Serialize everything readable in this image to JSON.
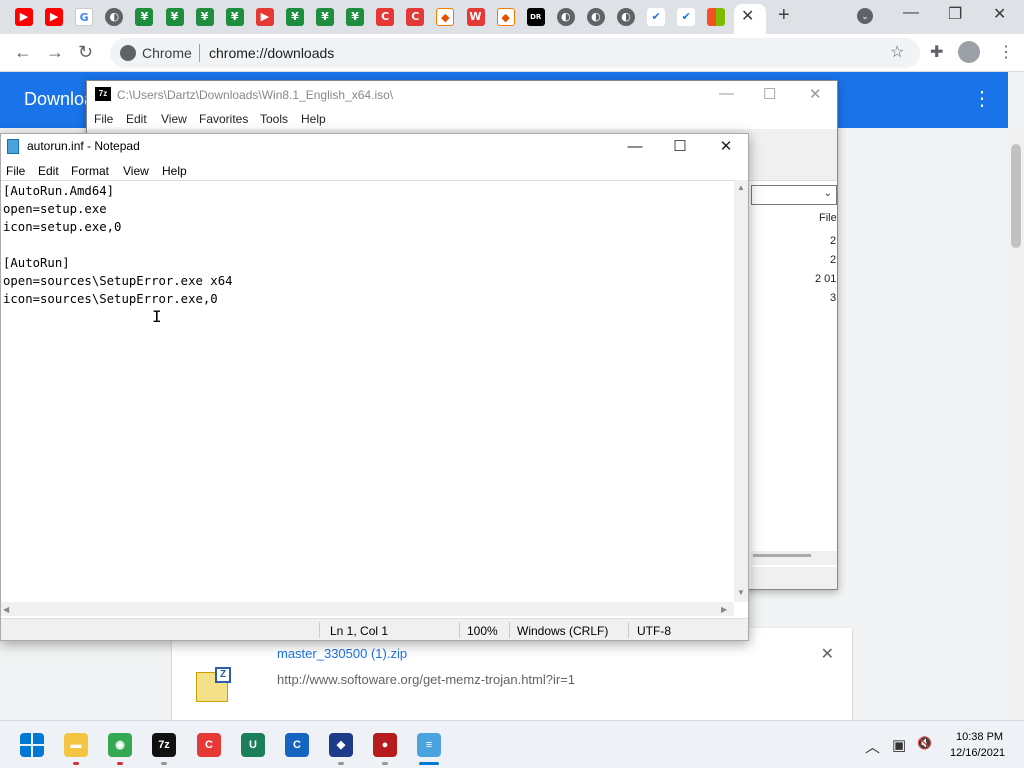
{
  "browser": {
    "tabs": [
      {
        "icon": "youtube-icon",
        "glyph": "▶",
        "style": "yt"
      },
      {
        "icon": "youtube-icon",
        "glyph": "▶",
        "style": "yt"
      },
      {
        "icon": "google-icon",
        "glyph": "G",
        "style": "gg"
      },
      {
        "icon": "globe-icon",
        "glyph": "◐",
        "style": "globe"
      },
      {
        "icon": "download-arrow-icon",
        "glyph": "¥",
        "style": "green"
      },
      {
        "icon": "download-arrow-icon",
        "glyph": "¥",
        "style": "green"
      },
      {
        "icon": "download-arrow-icon",
        "glyph": "¥",
        "style": "green"
      },
      {
        "icon": "download-arrow-icon",
        "glyph": "¥",
        "style": "green"
      },
      {
        "icon": "play-logo-icon",
        "glyph": "▶",
        "style": "red"
      },
      {
        "icon": "download-arrow-icon",
        "glyph": "¥",
        "style": "green"
      },
      {
        "icon": "download-arrow-icon",
        "glyph": "¥",
        "style": "green"
      },
      {
        "icon": "download-arrow-icon",
        "glyph": "¥",
        "style": "green"
      },
      {
        "icon": "ccleaner-icon",
        "glyph": "C",
        "style": "red"
      },
      {
        "icon": "ccleaner-icon",
        "glyph": "C",
        "style": "red"
      },
      {
        "icon": "diamond-icon",
        "glyph": "◆",
        "style": "orange"
      },
      {
        "icon": "w-logo-icon",
        "glyph": "W",
        "style": "red"
      },
      {
        "icon": "diamond-icon",
        "glyph": "◆",
        "style": "orange"
      },
      {
        "icon": "dr-logo-icon",
        "glyph": "DR",
        "style": "dark"
      },
      {
        "icon": "globe-icon",
        "glyph": "◐",
        "style": "globe"
      },
      {
        "icon": "globe-icon",
        "glyph": "◐",
        "style": "globe"
      },
      {
        "icon": "globe-icon",
        "glyph": "◐",
        "style": "globe"
      },
      {
        "icon": "checkmark-icon",
        "glyph": "✔",
        "style": "blue"
      },
      {
        "icon": "checkmark-icon",
        "glyph": "✔",
        "style": "blue"
      },
      {
        "icon": "microsoft-icon",
        "glyph": "",
        "style": "ms"
      }
    ],
    "active_tab_close": "✕",
    "new_tab": "+",
    "tab_search": "⌄",
    "window_min": "—",
    "window_restore": "❐",
    "window_close": "✕",
    "back": "←",
    "forward": "→",
    "reload": "↻",
    "omnibox_label": "Chrome",
    "url": "chrome://downloads",
    "bookmark_star": "☆",
    "extensions": "✚",
    "menu": "⋮"
  },
  "downloads_page": {
    "title": "Downloa",
    "more_menu": "⋮",
    "item": {
      "file_name": "master_330500 (1).zip",
      "url": "http://www.softoware.org/get-memz-trojan.html?ir=1",
      "remove": "✕",
      "badge": "Z"
    }
  },
  "sevenzip": {
    "app_badge": "7z",
    "title": "C:\\Users\\Dartz\\Downloads\\Win8.1_English_x64.iso\\",
    "menu": [
      "File",
      "Edit",
      "View",
      "Favorites",
      "Tools",
      "Help"
    ],
    "combo_arrow": "⌄",
    "column_header": "File",
    "cells": [
      "2",
      "2",
      "2 01",
      "3"
    ],
    "min": "—",
    "max": "☐",
    "close": "✕"
  },
  "notepad": {
    "title": "autorun.inf - Notepad",
    "menu": [
      "File",
      "Edit",
      "Format",
      "View",
      "Help"
    ],
    "lines": [
      "[AutoRun.Amd64]",
      "open=setup.exe",
      "icon=setup.exe,0",
      "",
      "[AutoRun]",
      "open=sources\\SetupError.exe x64",
      "icon=sources\\SetupError.exe,0"
    ],
    "cursor": "I",
    "status": {
      "position": "Ln 1, Col 1",
      "zoom": "100%",
      "line_ending": "Windows (CRLF)",
      "encoding": "UTF-8"
    },
    "min": "—",
    "max": "☐",
    "close": "✕",
    "scroll_up": "▲",
    "scroll_down": "▼",
    "scroll_left": "◀",
    "scroll_right": "▶"
  },
  "taskbar": {
    "apps": [
      {
        "name": "start-button",
        "glyph": "",
        "color": "#0078d4"
      },
      {
        "name": "file-explorer-icon",
        "glyph": "▬",
        "color": "#f4c542",
        "indicator": "#d13438"
      },
      {
        "name": "chrome-icon",
        "glyph": "◉",
        "color": "#34a853",
        "indicator": "#d13438"
      },
      {
        "name": "7zip-icon",
        "glyph": "7z",
        "color": "#111111",
        "indicator": "#999999"
      },
      {
        "name": "ccleaner-icon",
        "glyph": "C",
        "color": "#e53935"
      },
      {
        "name": "u-app-icon",
        "glyph": "U",
        "color": "#1b7f5a"
      },
      {
        "name": "ccleaner-blue-icon",
        "glyph": "C",
        "color": "#1565c0"
      },
      {
        "name": "shield-app-icon",
        "glyph": "◆",
        "color": "#1e3a8a",
        "indicator": "#999999"
      },
      {
        "name": "recorder-icon",
        "glyph": "●",
        "color": "#b71c1c",
        "indicator": "#999999"
      },
      {
        "name": "notepad-icon",
        "glyph": "≡",
        "color": "#4aa3df",
        "indicator": "#0078d4"
      }
    ],
    "tray_chevron": "︿",
    "tray_network": "▣",
    "tray_volume": "🔇",
    "time": "10:38 PM",
    "date": "12/16/2021"
  }
}
